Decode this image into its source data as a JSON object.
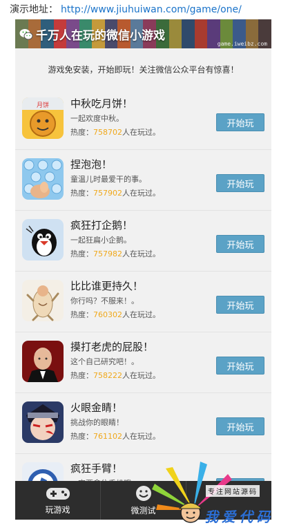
{
  "demo": {
    "label": "演示地址：",
    "url": "http://www.jiuhuiwan.com/game/one/"
  },
  "banner": {
    "title": "千万人在玩的微信小游戏",
    "domain": "game.iweibz.com",
    "stripe_colors": [
      "#6b7a52",
      "#a86b3a",
      "#2f5e7c",
      "#c43b3b",
      "#7a4a8a",
      "#3a8a6b",
      "#c49a3b",
      "#4a4a6b",
      "#b85a2f",
      "#5a7a9a",
      "#8a3b5a",
      "#3b6b3b",
      "#9a8a3b",
      "#2f4a6b",
      "#a83b2f",
      "#5a3b7a",
      "#6b8a3b",
      "#3b5a8a",
      "#8a6b3b",
      "#4a3b3b"
    ]
  },
  "notice": "游戏免安装，开始即玩！关注微信公众平台有惊喜！",
  "heat_label": "热度：",
  "heat_suffix": "人在玩过。",
  "play_label": "开始玩",
  "games": [
    {
      "name": "中秋吃月饼！",
      "desc": "一起欢度中秋。",
      "heat": "758702"
    },
    {
      "name": "捏泡泡！",
      "desc": "童温儿时最爱干的事。",
      "heat": "757902"
    },
    {
      "name": "疯狂打企鹅！",
      "desc": "一起狂扁小企鹅。",
      "heat": "757982"
    },
    {
      "name": "比比谁更持久！",
      "desc": "你行吗？不服来！。",
      "heat": "760302"
    },
    {
      "name": "摸打老虎的屁股！",
      "desc": "这个自己研究吧！。",
      "heat": "758222"
    },
    {
      "name": "火眼金睛！",
      "desc": "挑战你的眼睛！",
      "heat": "761102"
    },
    {
      "name": "疯狂手臂！",
      "desc": "一定要拿住手机哦",
      "heat": ""
    }
  ],
  "nav": {
    "play_games": "玩游戏",
    "micro_test": "微测试"
  },
  "watermark": {
    "top": "专注网站源码",
    "main": "我爱代码"
  }
}
